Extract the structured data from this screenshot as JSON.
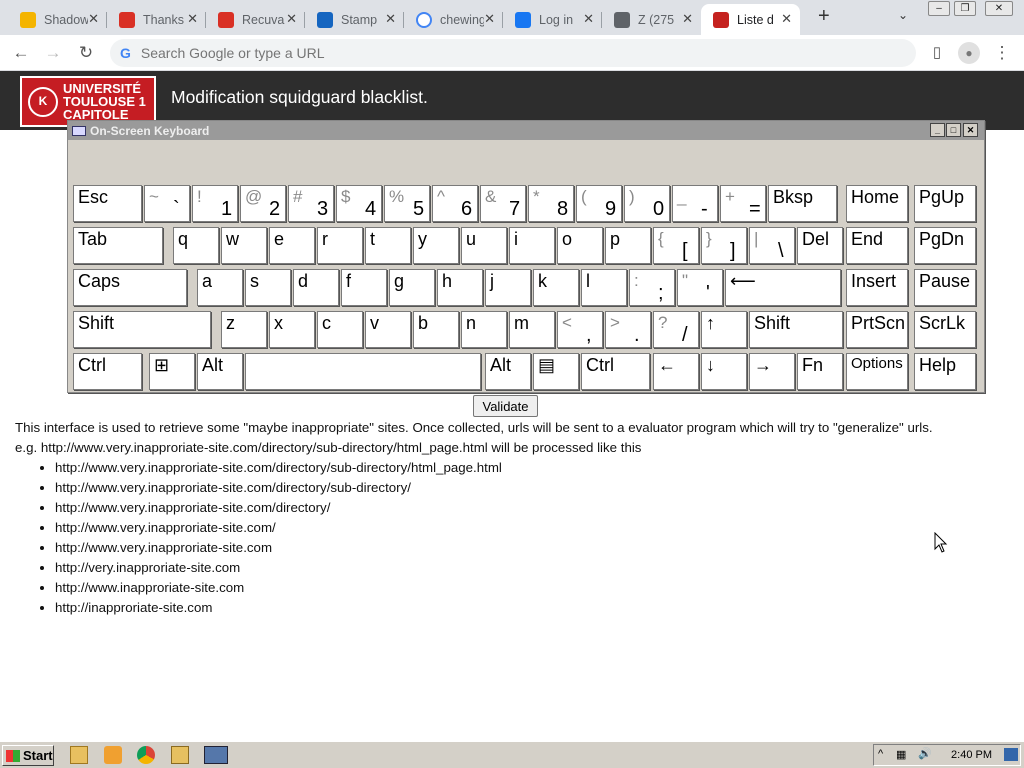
{
  "browser": {
    "tabs": [
      {
        "title": "Shadow",
        "fav_color": "#f4b400"
      },
      {
        "title": "Thanks",
        "fav_color": "#d93025"
      },
      {
        "title": "Recuva",
        "fav_color": "#d93025"
      },
      {
        "title": "Stamp",
        "fav_color": "#1565c0"
      },
      {
        "title": "chewing",
        "fav_color": "#ffffff"
      },
      {
        "title": "Log in",
        "fav_color": "#1877f2"
      },
      {
        "title": "Z (275",
        "fav_color": "#5f6368"
      },
      {
        "title": "Liste d",
        "fav_color": "#c5221f"
      }
    ],
    "new_tab_icon": "+",
    "tab_menu_icon": "⌄",
    "close_glyph": "✕",
    "window_controls": [
      "‒",
      "❐",
      "✕"
    ],
    "nav": {
      "back": "←",
      "forward": "→",
      "reload": "↻"
    },
    "omnibox_placeholder": "Search Google or type a URL",
    "menu_icons": [
      "▯",
      "●",
      "⋮"
    ]
  },
  "site": {
    "logo_lines": [
      "UNIVERSITÉ",
      "TOULOUSE 1",
      "CAPITOLE"
    ],
    "logo_seal": "K",
    "title": "Modification squidguard blacklist."
  },
  "osk": {
    "title": "On-Screen Keyboard",
    "controls": [
      "_",
      "□",
      "✕"
    ],
    "keys": [
      {
        "t": "Esc"
      },
      {
        "s": "~",
        "b": "`"
      },
      {
        "s": "!",
        "b": "1"
      },
      {
        "s": "@",
        "b": "2"
      },
      {
        "s": "#",
        "b": "3"
      },
      {
        "s": "$",
        "b": "4"
      },
      {
        "s": "%",
        "b": "5"
      },
      {
        "s": "^",
        "b": "6"
      },
      {
        "s": "&",
        "b": "7"
      },
      {
        "s": "*",
        "b": "8"
      },
      {
        "s": "(",
        "b": "9"
      },
      {
        "s": ")",
        "b": "0"
      },
      {
        "s": "_",
        "b": "-"
      },
      {
        "s": "+",
        "b": "="
      },
      {
        "t": "Bksp"
      },
      {
        "t": "Home"
      },
      {
        "t": "PgUp"
      },
      {
        "t": "Tab"
      },
      {
        "m": "q"
      },
      {
        "m": "w"
      },
      {
        "m": "e"
      },
      {
        "m": "r"
      },
      {
        "m": "t"
      },
      {
        "m": "y"
      },
      {
        "m": "u"
      },
      {
        "m": "i"
      },
      {
        "m": "o"
      },
      {
        "m": "p"
      },
      {
        "s": "{",
        "b": "["
      },
      {
        "s": "}",
        "b": "]"
      },
      {
        "s": "|",
        "b": "\\"
      },
      {
        "t": "Del"
      },
      {
        "t": "End"
      },
      {
        "t": "PgDn"
      },
      {
        "t": "Caps"
      },
      {
        "m": "a"
      },
      {
        "m": "s"
      },
      {
        "m": "d"
      },
      {
        "m": "f"
      },
      {
        "m": "g"
      },
      {
        "m": "h"
      },
      {
        "m": "j"
      },
      {
        "m": "k"
      },
      {
        "m": "l"
      },
      {
        "s": ":",
        "b": ";"
      },
      {
        "s": "\"",
        "b": "'"
      },
      {
        "t": "⟵"
      },
      {
        "t": "Insert"
      },
      {
        "t": "Pause"
      },
      {
        "t": "Shift"
      },
      {
        "m": "z"
      },
      {
        "m": "x"
      },
      {
        "m": "c"
      },
      {
        "m": "v"
      },
      {
        "m": "b"
      },
      {
        "m": "n"
      },
      {
        "m": "m"
      },
      {
        "s": "<",
        "b": ","
      },
      {
        "s": ">",
        "b": "."
      },
      {
        "s": "?",
        "b": "/"
      },
      {
        "t": "↑"
      },
      {
        "t": "Shift"
      },
      {
        "t": "PrtScn"
      },
      {
        "t": "ScrLk"
      },
      {
        "t": "Ctrl"
      },
      {
        "t": "⊞"
      },
      {
        "t": "Alt"
      },
      {
        "t": ""
      },
      {
        "t": "Alt"
      },
      {
        "t": "▤"
      },
      {
        "t": "Ctrl"
      },
      {
        "t": "←"
      },
      {
        "t": "↓"
      },
      {
        "t": "→"
      },
      {
        "t": "Fn"
      },
      {
        "t": "Options"
      },
      {
        "t": "Help"
      }
    ]
  },
  "form": {
    "validate_label": "Validate"
  },
  "content": {
    "intro1": "This interface is used to retrieve some \"maybe inappropriate\" sites. Once collected, urls will be sent to a evaluator program which will try to \"generalize\" urls.",
    "intro2": "e.g. http://www.very.inapproriate-site.com/directory/sub-directory/html_page.html will be processed like this",
    "urls": [
      "http://www.very.inapproriate-site.com/directory/sub-directory/html_page.html",
      "http://www.very.inapproriate-site.com/directory/sub-directory/",
      "http://www.very.inapproriate-site.com/directory/",
      "http://www.very.inapproriate-site.com/",
      "http://www.very.inapproriate-site.com",
      "http://very.inapproriate-site.com",
      "http://www.inapproriate-site.com",
      "http://inapproriate-site.com"
    ]
  },
  "taskbar": {
    "start_label": "Start",
    "clock": "2:40 PM",
    "tray_icons": [
      "^",
      "▦",
      "🔊"
    ]
  }
}
